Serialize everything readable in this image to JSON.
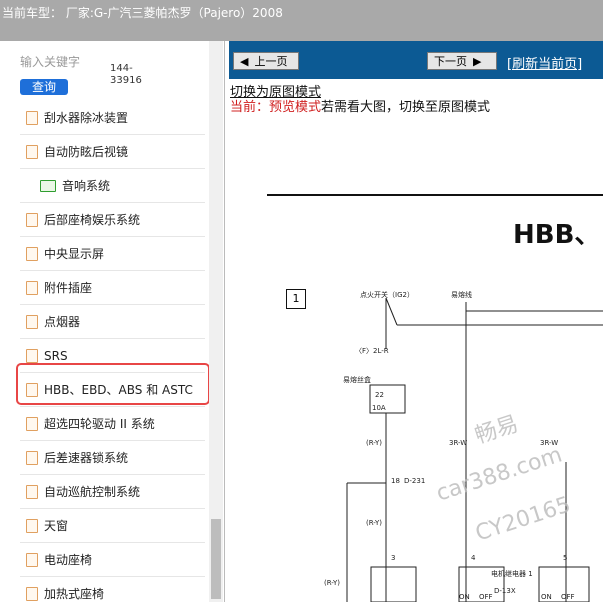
{
  "top": {
    "label": "当前车型：",
    "vehicle": "厂家:G-广汽三菱帕杰罗（Pajero）2008"
  },
  "search": {
    "placeholder": "输入关键字",
    "button": "查询",
    "code": "144-33916"
  },
  "sidebar": {
    "items": [
      {
        "label": "刮水器除冰装置"
      },
      {
        "label": "自动防眩后视镜"
      },
      {
        "label": "音响系统",
        "type": "folder"
      },
      {
        "label": "后部座椅娱乐系统"
      },
      {
        "label": "中央显示屏"
      },
      {
        "label": "附件插座"
      },
      {
        "label": "点烟器"
      },
      {
        "label": "SRS"
      },
      {
        "label": "HBB、EBD、ABS 和 ASTC"
      },
      {
        "label": "超选四轮驱动 II 系统"
      },
      {
        "label": "后差速器锁系统"
      },
      {
        "label": "自动巡航控制系统"
      },
      {
        "label": "天窗"
      },
      {
        "label": "电动座椅"
      },
      {
        "label": "加热式座椅"
      }
    ]
  },
  "viewer": {
    "prev": "上一页",
    "next": "下一页",
    "refresh": "[刷新当前页]",
    "switch_link": "切换为原图模式",
    "current_prefix": "当前：",
    "current_mode": "预览模式",
    "current_hint": "若需看大图，切换至原图模式"
  },
  "diagram": {
    "title": "HBB、",
    "box": "1",
    "labels": [
      "点火开关（IG2）",
      "易熔线",
      "〈F〉2L-R",
      "易熔丝盒",
      "22",
      "10A",
      "(R-Y)",
      "3R-W",
      "3R-W",
      "18",
      "D-231",
      "(R-Y)",
      "3",
      "4",
      "5",
      "(R-Y)",
      "电机继电器 1",
      "D-13X",
      "ON",
      "OFF",
      "ON",
      "OFF"
    ]
  },
  "watermark": {
    "line1": "畅易",
    "line2": "car388.com",
    "line3": "CY20165"
  }
}
